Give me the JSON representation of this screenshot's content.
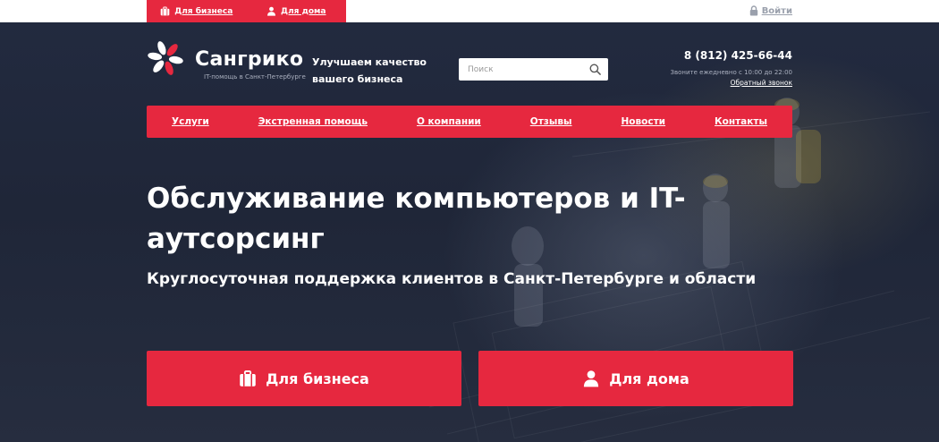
{
  "topbar": {
    "business_label": "Для бизнеса",
    "home_label": "Для дома",
    "login_label": "Войти"
  },
  "header": {
    "logo_name": "Сангрико",
    "logo_sub": "IT-помощь в Санкт-Петербурге",
    "slogan": "Улучшаем качество вашего бизнеса",
    "search_placeholder": "Поиск",
    "phone": "8 (812) 425-66-44",
    "hours": "Звоните ежедневно с 10:00 до 22:00",
    "callback": "Обратный звонок"
  },
  "nav": {
    "items": [
      "Услуги",
      "Экстренная помощь",
      "О компании",
      "Отзывы",
      "Новости",
      "Контакты"
    ]
  },
  "hero": {
    "title": "Обслуживание компьютеров и IT-аутсорсинг",
    "subtitle": "Круглосуточная поддержка клиентов в Санкт-Петербурге и области"
  },
  "cta": {
    "business_label": "Для бизнеса",
    "home_label": "Для дома"
  },
  "colors": {
    "accent": "#e6283f",
    "background": "#1d2438",
    "text": "#ffffff"
  },
  "icons": [
    "briefcase-icon",
    "user-icon",
    "lock-icon",
    "search-icon",
    "logo-icon"
  ]
}
